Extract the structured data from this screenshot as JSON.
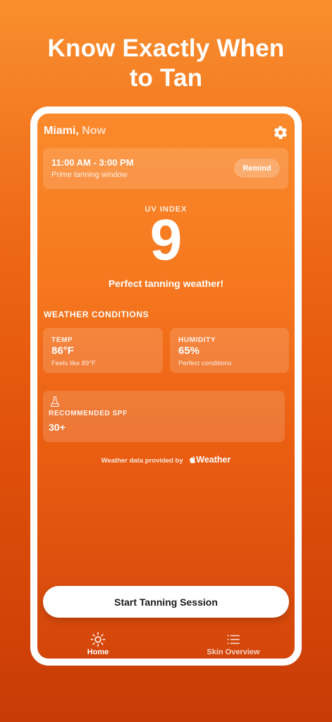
{
  "headline": {
    "line1": "Know Exactly When",
    "line2": "to Tan"
  },
  "location": {
    "city": "Miami,",
    "time": "Now"
  },
  "icons": {
    "settings": "gear-icon",
    "spf": "flask-icon",
    "home_tab": "sun-icon",
    "skin_tab": "list-icon",
    "brand": "apple-logo-icon"
  },
  "tanning_window": {
    "time_range": "11:00 AM - 3:00 PM",
    "label": "Prime tanning window",
    "remind_label": "Remind"
  },
  "uv": {
    "label": "UV INDEX",
    "value": "9",
    "message": "Perfect tanning weather!"
  },
  "conditions": {
    "title": "WEATHER CONDITIONS",
    "temp": {
      "label": "TEMP",
      "value": "86°F",
      "sub": "Feels like 89°F"
    },
    "humidity": {
      "label": "HUMIDITY",
      "value": "65%",
      "sub": "Perfect conditions"
    }
  },
  "spf": {
    "label": "RECOMMENDED SPF",
    "value": "30+"
  },
  "attribution": {
    "prefix": "Weather data provided by",
    "brand": "Weather"
  },
  "primary_action": {
    "label": "Start Tanning Session"
  },
  "tabs": [
    {
      "label": "Home",
      "active": true
    },
    {
      "label": "Skin Overview",
      "active": false
    }
  ],
  "colors": {
    "background_top": "#f98f2f",
    "background_bottom": "#c83b06",
    "card": "rgba(255,255,255,0.15)",
    "button": "#ffffff"
  }
}
